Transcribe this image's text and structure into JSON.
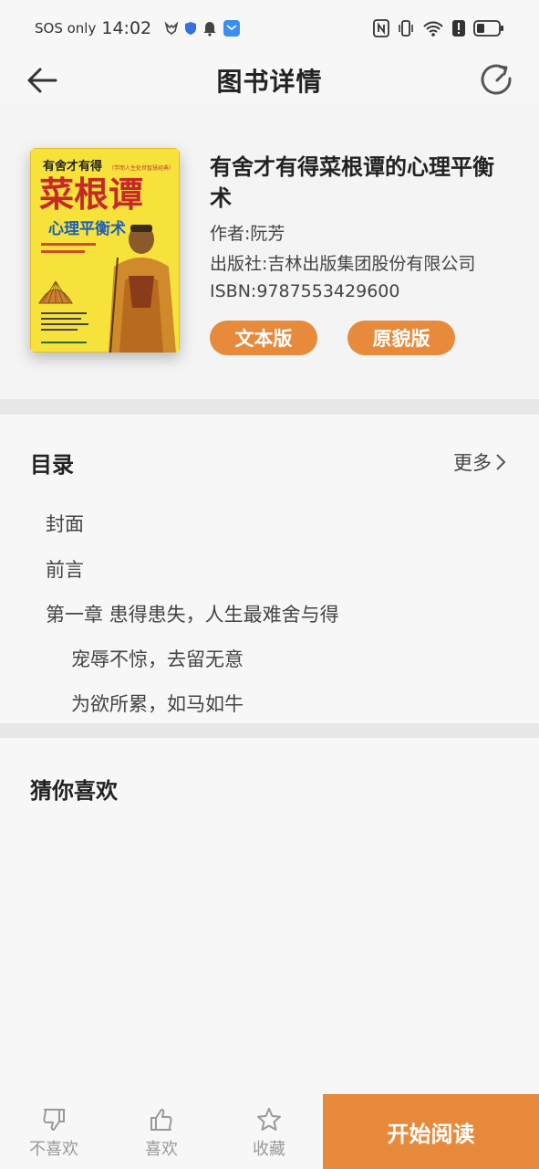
{
  "status_bar": {
    "carrier": "SOS only",
    "time": "14:02"
  },
  "header": {
    "title": "图书详情"
  },
  "book": {
    "title": "有舍才有得菜根谭的心理平衡术",
    "author": "作者:阮芳",
    "publisher": "出版社:吉林出版集团股份有限公司",
    "isbn": "ISBN:9787553429600",
    "cover": {
      "top_text": "有舍才有得",
      "badge_text": "〔学而人生处世智慧经典〕",
      "main_title": "菜根谭",
      "subtitle": "心理平衡术"
    },
    "buttons": {
      "text_version": "文本版",
      "original_version": "原貌版"
    }
  },
  "toc": {
    "title": "目录",
    "more": "更多",
    "items": [
      {
        "label": "封面"
      },
      {
        "label": "前言"
      },
      {
        "label": "第一章 患得患失，人生最难舍与得"
      },
      {
        "label": "宠辱不惊，去留无意"
      },
      {
        "label": "为欲所累，如马如牛"
      }
    ]
  },
  "recommend": {
    "title": "猜你喜欢"
  },
  "bottom_bar": {
    "dislike": "不喜欢",
    "like": "喜欢",
    "favorite": "收藏",
    "start_reading": "开始阅读"
  },
  "colors": {
    "accent": "#e88a3b",
    "background": "#f7f7f7"
  }
}
